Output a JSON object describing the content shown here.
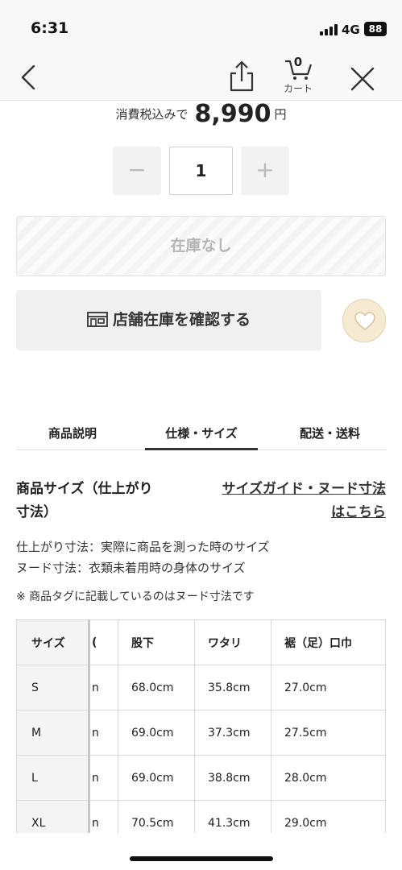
{
  "status_bar": {
    "time": "6:31",
    "network": "4G",
    "battery": "88"
  },
  "nav": {
    "cart_count": "0",
    "cart_label": "カート"
  },
  "price": {
    "prefix": "消費税込みで",
    "value": "8,990",
    "unit": "円"
  },
  "quantity": {
    "minus": "−",
    "value": "1",
    "plus": "+"
  },
  "out_of_stock_label": "在庫なし",
  "store_stock_label": "店舗在庫を確認する",
  "tabs": [
    {
      "label": "商品説明"
    },
    {
      "label": "仕様・サイズ"
    },
    {
      "label": "配送・送料"
    }
  ],
  "size_section": {
    "heading_line1": "商品サイズ（仕上がり",
    "heading_line2": "寸法）",
    "guide_link_line1": "サイズガイド・ヌード寸法",
    "guide_link_line2": "はこちら",
    "note1": "仕上がり寸法：実際に商品を測った時のサイズ",
    "note2": "ヌード寸法：衣類未着用時の身体のサイズ",
    "note3": "※ 商品タグに記載しているのはヌード寸法です"
  },
  "size_table": {
    "headers": [
      "サイズ",
      "(",
      "股下",
      "ワタリ",
      "裾（足）口巾"
    ],
    "rows": [
      [
        "S",
        "n",
        "68.0cm",
        "35.8cm",
        "27.0cm"
      ],
      [
        "M",
        "n",
        "69.0cm",
        "37.3cm",
        "27.5cm"
      ],
      [
        "L",
        "n",
        "69.0cm",
        "38.8cm",
        "28.0cm"
      ],
      [
        "XL",
        "n",
        "70.5cm",
        "41.3cm",
        "29.0cm"
      ]
    ]
  },
  "icons": {
    "back": "chevron-left-icon",
    "share": "share-icon",
    "cart": "cart-icon",
    "close": "close-icon",
    "store": "store-icon",
    "favorite": "heart-icon"
  },
  "colors": {
    "favorite_bg": "#f6ead2",
    "active_tab_underline": "#333333"
  }
}
